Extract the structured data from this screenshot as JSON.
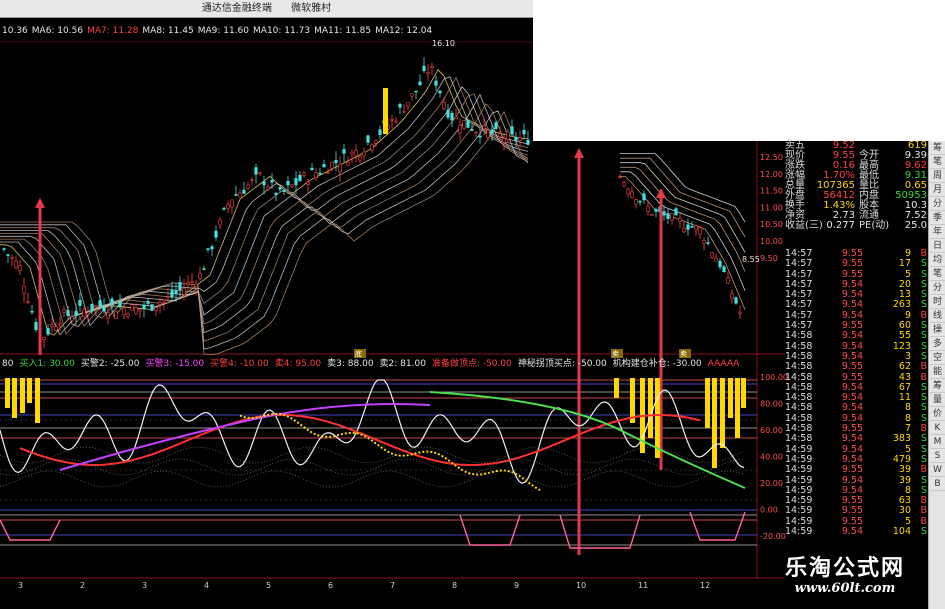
{
  "window": {
    "title": "通达信金融终端",
    "title_tab": "微软雅村"
  },
  "ma_bar": [
    {
      "label": "10.36",
      "color": "#e6e6e6"
    },
    {
      "label": "MA6: 10.56",
      "color": "#e6e6e6"
    },
    {
      "label": "MA7: 11.28",
      "color": "#ff4040"
    },
    {
      "label": "MA8: 11.45",
      "color": "#e6e6e6"
    },
    {
      "label": "MA9: 11.60",
      "color": "#e6e6e6"
    },
    {
      "label": "MA10: 11.73",
      "color": "#e6e6e6"
    },
    {
      "label": "MA11: 11.85",
      "color": "#e6e6e6"
    },
    {
      "label": "MA12: 12.04",
      "color": "#e6e6e6"
    }
  ],
  "indicator_bar": [
    {
      "label": "80",
      "color": "#e6e6e6"
    },
    {
      "label": "买入1: 30.00",
      "color": "#3bd63b"
    },
    {
      "label": "买警2: -25.00",
      "color": "#e6e6e6"
    },
    {
      "label": "买警3: -15.00",
      "color": "#ff40ff"
    },
    {
      "label": "买警4: -10.00",
      "color": "#ff4040"
    },
    {
      "label": "卖4: 95.00",
      "color": "#ff4040"
    },
    {
      "label": "卖3: 88.00",
      "color": "#e6e6e6"
    },
    {
      "label": "卖2: 81.00",
      "color": "#e6e6e6"
    },
    {
      "label": "准备做顶点: -50.00",
      "color": "#ff4040"
    },
    {
      "label": "神秘拐顶买点: -50.00",
      "color": "#e6e6e6"
    },
    {
      "label": "机构建仓补仓: -30.00",
      "color": "#e6e6e6"
    },
    {
      "label": "AAAAA",
      "color": "#ff4040"
    }
  ],
  "price_chart": {
    "high_label": "16.10",
    "low_label": "8.55",
    "signals": [
      "底部",
      "卖出",
      "卖出"
    ],
    "mid_axis": [
      "12.50",
      "12.00",
      "11.50",
      "11.00",
      "10.50",
      "10.00",
      "9.50"
    ]
  },
  "indicator_axis": [
    "100.00",
    "80.00",
    "60.00",
    "40.00",
    "20.00",
    "0.00",
    "-20.00"
  ],
  "x_axis": [
    "3",
    "2",
    "3",
    "4",
    "5",
    "6",
    "7",
    "8",
    "9",
    "10",
    "11",
    "12"
  ],
  "quote": {
    "rows": [
      {
        "l": "卖五",
        "v": "9.52",
        "l2": "",
        "v2": "619",
        "c": "#ff4040",
        "c2": "#ffd800"
      },
      {
        "l": "现价",
        "v": "9.55",
        "l2": "今开",
        "v2": "9.39",
        "c": "#ff4040",
        "c2": "#e6e6e6"
      },
      {
        "l": "涨跌",
        "v": "0.16",
        "l2": "最高",
        "v2": "9.62",
        "c": "#ff4040",
        "c2": "#ff4040"
      },
      {
        "l": "涨幅",
        "v": "1.70%",
        "l2": "最低",
        "v2": "9.31",
        "c": "#ff4040",
        "c2": "#3bd63b"
      },
      {
        "l": "总量",
        "v": "107365",
        "l2": "量比",
        "v2": "0.65",
        "c": "#ffd800",
        "c2": "#ffd800"
      },
      {
        "l": "外盘",
        "v": "56412",
        "l2": "内盘",
        "v2": "50953",
        "c": "#ff4040",
        "c2": "#3bd63b"
      },
      {
        "l": "换手",
        "v": "1.43%",
        "l2": "股本",
        "v2": "10.3",
        "c": "#ffd800",
        "c2": "#e6e6e6"
      },
      {
        "l": "净资",
        "v": "2.73",
        "l2": "流通",
        "v2": "7.52",
        "c": "#e6e6e6",
        "c2": "#e6e6e6"
      },
      {
        "l": "收益(三)",
        "v": "0.277",
        "l2": "PE(动)",
        "v2": "25.0",
        "c": "#e6e6e6",
        "c2": "#e6e6e6"
      }
    ]
  },
  "ticks": [
    {
      "t": "14:57",
      "p": "9.55",
      "q": "9",
      "s": "B"
    },
    {
      "t": "14:57",
      "p": "9.55",
      "q": "17",
      "s": "S"
    },
    {
      "t": "14:57",
      "p": "9.55",
      "q": "5",
      "s": "S"
    },
    {
      "t": "14:57",
      "p": "9.54",
      "q": "20",
      "s": "S"
    },
    {
      "t": "14:57",
      "p": "9.54",
      "q": "13",
      "s": "S"
    },
    {
      "t": "14:57",
      "p": "9.54",
      "q": "263",
      "s": "S"
    },
    {
      "t": "14:57",
      "p": "9.54",
      "q": "9",
      "s": "B"
    },
    {
      "t": "14:57",
      "p": "9.55",
      "q": "60",
      "s": "S"
    },
    {
      "t": "14:58",
      "p": "9.54",
      "q": "55",
      "s": "S"
    },
    {
      "t": "14:58",
      "p": "9.54",
      "q": "123",
      "s": "S"
    },
    {
      "t": "14:58",
      "p": "9.54",
      "q": "3",
      "s": "S"
    },
    {
      "t": "14:58",
      "p": "9.55",
      "q": "62",
      "s": "B"
    },
    {
      "t": "14:58",
      "p": "9.55",
      "q": "43",
      "s": "B"
    },
    {
      "t": "14:58",
      "p": "9.54",
      "q": "67",
      "s": "S"
    },
    {
      "t": "14:58",
      "p": "9.54",
      "q": "11",
      "s": "S"
    },
    {
      "t": "14:58",
      "p": "9.54",
      "q": "8",
      "s": "S"
    },
    {
      "t": "14:58",
      "p": "9.54",
      "q": "8",
      "s": "S"
    },
    {
      "t": "14:58",
      "p": "9.55",
      "q": "7",
      "s": "B"
    },
    {
      "t": "14:58",
      "p": "9.54",
      "q": "383",
      "s": "S"
    },
    {
      "t": "14:59",
      "p": "9.54",
      "q": "5",
      "s": "S"
    },
    {
      "t": "14:59",
      "p": "9.54",
      "q": "479",
      "s": "S"
    },
    {
      "t": "14:59",
      "p": "9.55",
      "q": "39",
      "s": "B"
    },
    {
      "t": "14:59",
      "p": "9.54",
      "q": "39",
      "s": "S"
    },
    {
      "t": "14:59",
      "p": "9.54",
      "q": "8",
      "s": "S"
    },
    {
      "t": "14:59",
      "p": "9.55",
      "q": "63",
      "s": "B"
    },
    {
      "t": "14:59",
      "p": "9.55",
      "q": "30",
      "s": "B"
    },
    {
      "t": "14:59",
      "p": "9.55",
      "q": "5",
      "s": "B"
    },
    {
      "t": "14:59",
      "p": "9.54",
      "q": "104",
      "s": "S"
    }
  ],
  "toolbar": [
    "筹",
    "笔",
    "周",
    "月",
    "分",
    "季",
    "年",
    "日",
    "均",
    "笔",
    "分",
    "时",
    "线",
    "操",
    "多",
    "空",
    "能",
    "筹",
    "量",
    "价",
    "K",
    "M",
    "S",
    "W",
    "B"
  ],
  "watermark": {
    "cn": "乐淘公式网",
    "url": "www.60lt.com"
  },
  "colors": {
    "background": "#000000",
    "up": "#ff4040",
    "down": "#3bd63b",
    "accent_yellow": "#ffd800",
    "volume_red": "#e23a4a",
    "magenta": "#c040ff"
  }
}
